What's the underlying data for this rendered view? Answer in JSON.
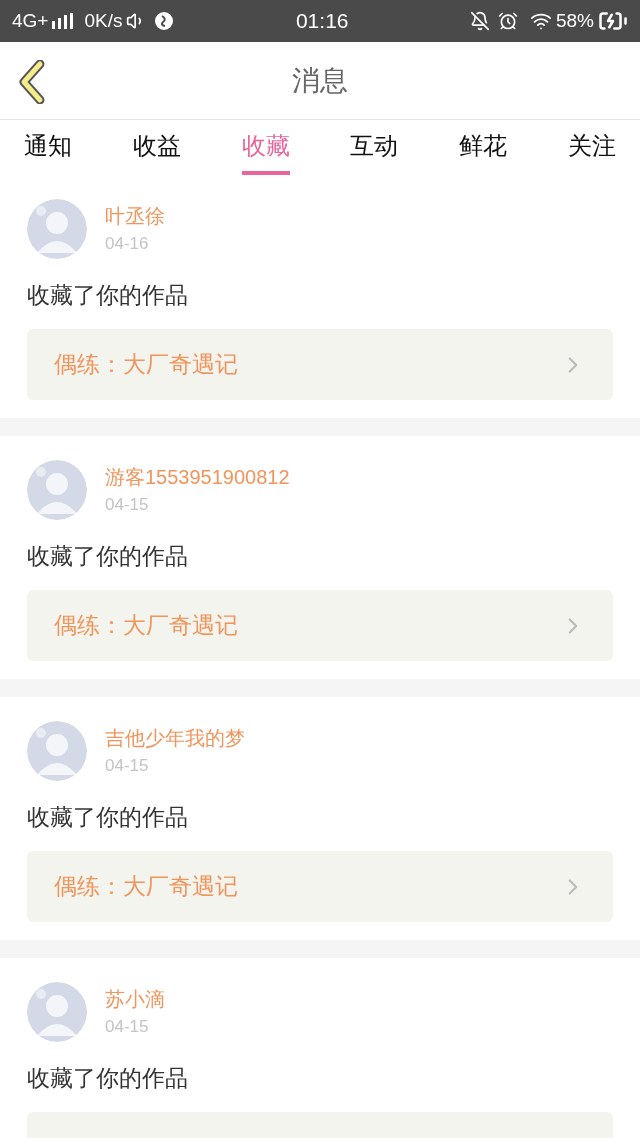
{
  "status_bar": {
    "network": "4G+",
    "speed": "0K/s",
    "time": "01:16",
    "battery": "58%"
  },
  "header": {
    "title": "消息"
  },
  "tabs": [
    {
      "label": "通知",
      "selected": false
    },
    {
      "label": "收益",
      "selected": false
    },
    {
      "label": "收藏",
      "selected": true
    },
    {
      "label": "互动",
      "selected": false
    },
    {
      "label": "鲜花",
      "selected": false
    },
    {
      "label": "关注",
      "selected": false
    }
  ],
  "messages": [
    {
      "name": "叶丞徐",
      "date": "04-16",
      "text": "收藏了你的作品",
      "work": "偶练：大厂奇遇记"
    },
    {
      "name": "游客1553951900812",
      "date": "04-15",
      "text": "收藏了你的作品",
      "work": "偶练：大厂奇遇记"
    },
    {
      "name": "吉他少年我的梦",
      "date": "04-15",
      "text": "收藏了你的作品",
      "work": "偶练：大厂奇遇记"
    },
    {
      "name": "苏小滴",
      "date": "04-15",
      "text": "收藏了你的作品"
    }
  ]
}
